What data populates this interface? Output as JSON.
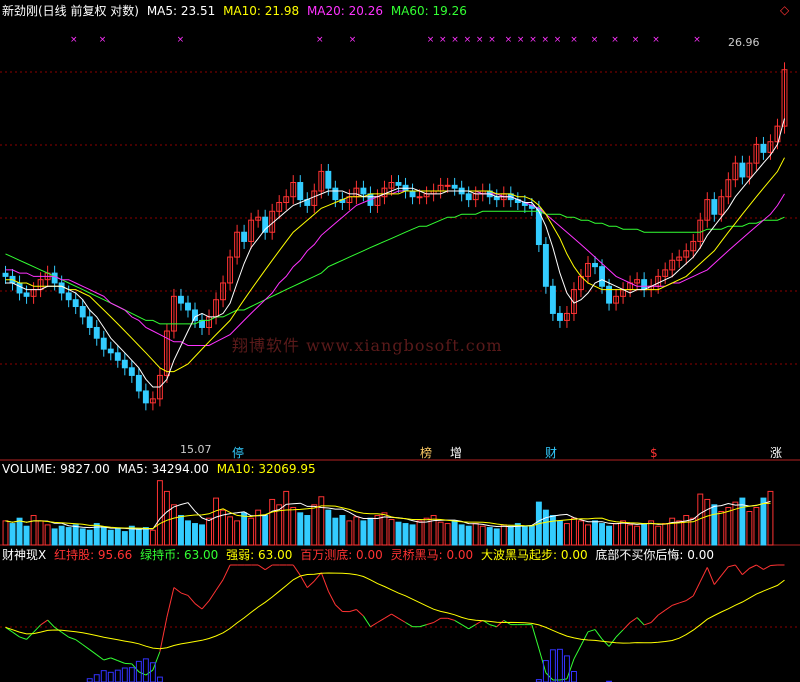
{
  "main_header": {
    "title": "新劲刚(日线 前复权 对数)",
    "ma5": "MA5: 23.51",
    "ma10": "MA10: 21.98",
    "ma20": "MA20: 20.26",
    "ma60": "MA60: 19.26",
    "corner_icon": "diamond-icon"
  },
  "watermark": "翔博软件 www.xiangbosoft.com",
  "price_labels": {
    "high": "26.96",
    "low": "15.07"
  },
  "signals": [
    {
      "text": "停",
      "color": "#33ccff"
    },
    {
      "text": "榜",
      "color": "#ffcc66"
    },
    {
      "text": "增",
      "color": "#ffffff"
    },
    {
      "text": "财",
      "color": "#33ccff"
    },
    {
      "text": "$",
      "color": "#ff3333"
    },
    {
      "text": "涨",
      "color": "#ffffff"
    }
  ],
  "volume_header": {
    "volume": "VOLUME: 9827.00",
    "ma5": "MA5: 34294.00",
    "ma10": "MA10: 32069.95"
  },
  "indicator_header": {
    "name": "财神现X",
    "items": [
      {
        "label": "红持股: 95.66",
        "color": "#ff3333"
      },
      {
        "label": "绿持币: 63.00",
        "color": "#33ff33"
      },
      {
        "label": "强弱: 63.00",
        "color": "#ffff00"
      },
      {
        "label": "百万测底: 0.00",
        "color": "#ff3333"
      },
      {
        "label": "灵桥黑马: 0.00",
        "color": "#ff3333"
      },
      {
        "label": "大波黑马起步: 0.00",
        "color": "#ffff00"
      },
      {
        "label": "底部不买你后悔: 0.00",
        "color": "#ffffff"
      }
    ]
  },
  "colors": {
    "up": "#ff3333",
    "down": "#33ccff",
    "ma5": "#ffffff",
    "ma10": "#ffff00",
    "ma20": "#ff33ff",
    "ma60": "#33ff33",
    "grid": "#8b0000"
  },
  "chart_data": {
    "type": "candlestick",
    "scale": "log",
    "bars": 120,
    "price_range": [
      15.07,
      26.96
    ],
    "close": [
      19.0,
      18.8,
      18.5,
      18.4,
      18.6,
      18.9,
      19.1,
      18.8,
      18.5,
      18.3,
      18.1,
      17.8,
      17.5,
      17.2,
      16.9,
      16.8,
      16.6,
      16.4,
      16.2,
      15.8,
      15.5,
      15.6,
      16.2,
      17.4,
      18.4,
      18.2,
      18.0,
      17.7,
      17.5,
      17.8,
      18.3,
      18.8,
      19.6,
      20.4,
      20.1,
      20.8,
      20.9,
      20.4,
      21.1,
      21.4,
      21.6,
      22.1,
      21.5,
      21.3,
      21.8,
      22.5,
      21.9,
      21.5,
      21.4,
      21.6,
      21.9,
      21.7,
      21.3,
      21.6,
      21.9,
      22.1,
      22.0,
      21.8,
      21.6,
      21.6,
      21.7,
      21.8,
      22.0,
      22.0,
      21.9,
      21.7,
      21.5,
      21.7,
      21.8,
      21.6,
      21.5,
      21.7,
      21.5,
      21.4,
      21.3,
      21.2,
      20.0,
      18.7,
      17.9,
      17.7,
      17.9,
      18.6,
      19.0,
      19.4,
      19.3,
      18.7,
      18.2,
      18.4,
      18.6,
      18.8,
      18.9,
      18.6,
      18.7,
      19.0,
      19.2,
      19.5,
      19.6,
      19.8,
      20.1,
      20.8,
      21.5,
      21.0,
      21.6,
      22.2,
      22.8,
      22.3,
      22.8,
      23.5,
      23.2,
      23.6,
      24.2,
      26.5
    ],
    "ma5": [
      18.8,
      18.8,
      18.7,
      18.6,
      18.6,
      18.6,
      18.7,
      18.7,
      18.7,
      18.6,
      18.5,
      18.3,
      18.0,
      17.8,
      17.5,
      17.2,
      17.0,
      16.8,
      16.6,
      16.4,
      16.1,
      15.9,
      15.9,
      16.1,
      16.6,
      17.0,
      17.4,
      17.8,
      17.9,
      17.8,
      17.8,
      17.9,
      18.2,
      18.8,
      19.4,
      19.9,
      20.2,
      20.5,
      20.7,
      20.9,
      21.1,
      21.3,
      21.4,
      21.5,
      21.6,
      21.7,
      21.8,
      21.8,
      21.8,
      21.7,
      21.7,
      21.6,
      21.6,
      21.6,
      21.7,
      21.8,
      21.9,
      21.9,
      21.9,
      21.8,
      21.7,
      21.7,
      21.7,
      21.8,
      21.8,
      21.8,
      21.8,
      21.7,
      21.7,
      21.7,
      21.6,
      21.6,
      21.6,
      21.5,
      21.4,
      21.4,
      21.1,
      20.6,
      19.9,
      19.1,
      18.5,
      18.2,
      18.3,
      18.5,
      18.8,
      18.9,
      18.8,
      18.7,
      18.6,
      18.5,
      18.6,
      18.6,
      18.7,
      18.8,
      18.9,
      19.0,
      19.2,
      19.4,
      19.6,
      19.9,
      20.3,
      20.6,
      20.9,
      21.2,
      21.6,
      21.9,
      22.2,
      22.5,
      22.8,
      23.1,
      23.5,
      24.5
    ],
    "ma10": [
      18.9,
      18.9,
      18.8,
      18.8,
      18.7,
      18.7,
      18.7,
      18.7,
      18.7,
      18.6,
      18.6,
      18.5,
      18.4,
      18.2,
      18.0,
      17.8,
      17.6,
      17.4,
      17.2,
      17.0,
      16.8,
      16.6,
      16.4,
      16.3,
      16.3,
      16.4,
      16.5,
      16.7,
      16.9,
      17.1,
      17.3,
      17.5,
      17.7,
      18.0,
      18.3,
      18.6,
      18.9,
      19.2,
      19.5,
      19.8,
      20.1,
      20.4,
      20.6,
      20.8,
      21.0,
      21.2,
      21.3,
      21.4,
      21.5,
      21.6,
      21.6,
      21.6,
      21.7,
      21.7,
      21.7,
      21.7,
      21.7,
      21.8,
      21.8,
      21.8,
      21.8,
      21.8,
      21.8,
      21.8,
      21.8,
      21.8,
      21.8,
      21.8,
      21.8,
      21.8,
      21.7,
      21.7,
      21.7,
      21.6,
      21.6,
      21.5,
      21.3,
      21.0,
      20.6,
      20.2,
      19.7,
      19.3,
      19.0,
      18.8,
      18.7,
      18.6,
      18.6,
      18.6,
      18.6,
      18.6,
      18.6,
      18.6,
      18.6,
      18.6,
      18.7,
      18.8,
      18.9,
      19.0,
      19.2,
      19.4,
      19.6,
      19.8,
      20.1,
      20.4,
      20.7,
      21.0,
      21.3,
      21.6,
      21.9,
      22.2,
      22.5,
      23.0
    ],
    "ma20": [
      19.2,
      19.2,
      19.1,
      19.1,
      19.0,
      19.0,
      19.0,
      19.0,
      18.9,
      18.9,
      18.8,
      18.7,
      18.6,
      18.5,
      18.4,
      18.2,
      18.1,
      18.0,
      17.8,
      17.7,
      17.5,
      17.4,
      17.3,
      17.2,
      17.1,
      17.1,
      17.0,
      17.0,
      17.0,
      17.0,
      17.1,
      17.2,
      17.3,
      17.5,
      17.7,
      17.9,
      18.1,
      18.3,
      18.5,
      18.8,
      19.0,
      19.3,
      19.5,
      19.8,
      20.0,
      20.3,
      20.5,
      20.7,
      20.9,
      21.1,
      21.3,
      21.4,
      21.5,
      21.6,
      21.7,
      21.7,
      21.8,
      21.8,
      21.8,
      21.8,
      21.8,
      21.8,
      21.8,
      21.8,
      21.8,
      21.8,
      21.8,
      21.8,
      21.7,
      21.7,
      21.7,
      21.6,
      21.6,
      21.5,
      21.4,
      21.3,
      21.2,
      21.0,
      20.8,
      20.6,
      20.4,
      20.2,
      20.0,
      19.8,
      19.6,
      19.4,
      19.2,
      19.0,
      18.9,
      18.8,
      18.7,
      18.7,
      18.7,
      18.7,
      18.7,
      18.8,
      18.8,
      18.9,
      19.0,
      19.1,
      19.2,
      19.4,
      19.6,
      19.8,
      20.0,
      20.2,
      20.4,
      20.6,
      20.8,
      21.0,
      21.3,
      21.7
    ],
    "ma60": [
      19.7,
      19.6,
      19.5,
      19.4,
      19.3,
      19.2,
      19.1,
      19.0,
      18.9,
      18.8,
      18.7,
      18.6,
      18.5,
      18.4,
      18.3,
      18.2,
      18.1,
      18.0,
      17.9,
      17.8,
      17.7,
      17.7,
      17.6,
      17.6,
      17.6,
      17.6,
      17.6,
      17.6,
      17.7,
      17.7,
      17.8,
      17.8,
      17.9,
      18.0,
      18.0,
      18.1,
      18.2,
      18.3,
      18.4,
      18.5,
      18.6,
      18.7,
      18.8,
      18.9,
      19.0,
      19.1,
      19.3,
      19.4,
      19.5,
      19.6,
      19.7,
      19.8,
      19.9,
      20.0,
      20.1,
      20.2,
      20.3,
      20.4,
      20.5,
      20.6,
      20.6,
      20.7,
      20.8,
      20.9,
      20.9,
      21.0,
      21.0,
      21.0,
      21.1,
      21.1,
      21.1,
      21.1,
      21.1,
      21.1,
      21.1,
      21.1,
      21.1,
      21.0,
      21.0,
      21.0,
      20.9,
      20.9,
      20.8,
      20.8,
      20.7,
      20.7,
      20.6,
      20.6,
      20.5,
      20.5,
      20.5,
      20.4,
      20.4,
      20.4,
      20.4,
      20.4,
      20.4,
      20.4,
      20.4,
      20.4,
      20.5,
      20.5,
      20.5,
      20.6,
      20.6,
      20.6,
      20.7,
      20.7,
      20.8,
      20.8,
      20.8,
      20.9
    ],
    "volume": [
      18,
      16,
      20,
      14,
      22,
      18,
      15,
      12,
      14,
      13,
      15,
      12,
      11,
      16,
      13,
      11,
      12,
      10,
      14,
      12,
      13,
      11,
      48,
      40,
      30,
      22,
      18,
      16,
      15,
      20,
      35,
      26,
      21,
      18,
      24,
      20,
      26,
      22,
      34,
      30,
      40,
      28,
      24,
      22,
      30,
      36,
      26,
      20,
      22,
      18,
      21,
      18,
      20,
      22,
      24,
      19,
      17,
      16,
      15,
      18,
      20,
      22,
      17,
      16,
      18,
      15,
      14,
      16,
      14,
      13,
      12,
      15,
      14,
      16,
      14,
      14,
      32,
      26,
      22,
      18,
      16,
      20,
      18,
      15,
      18,
      16,
      14,
      16,
      18,
      15,
      14,
      16,
      18,
      14,
      16,
      20,
      18,
      22,
      20,
      38,
      34,
      30,
      25,
      28,
      32,
      35,
      25,
      28,
      35,
      40
    ]
  }
}
